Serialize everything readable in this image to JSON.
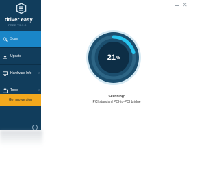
{
  "window": {
    "controls": [
      {
        "name": "minimize",
        "glyph": ""
      },
      {
        "name": "close",
        "glyph": "✕"
      }
    ]
  },
  "sidebar": {
    "brand": "driver easy",
    "version": "FREE V5.5.0",
    "items": [
      {
        "label": "Scan",
        "icon": "search-icon",
        "active": true
      },
      {
        "label": "Update",
        "icon": "update-icon",
        "active": false
      },
      {
        "label": "Hardware Info",
        "icon": "monitor-icon",
        "active": false,
        "submenu": "›"
      },
      {
        "label": "Tools",
        "icon": "toolbox-icon",
        "active": false,
        "submenu": "›"
      }
    ],
    "pro_button": "Get pro version",
    "chat_glyph": "…"
  },
  "scan": {
    "percent": 21,
    "percent_text": "21",
    "percent_sign": "%",
    "title": "Scanning:",
    "detail": "PCI standard PCI-to-PCI bridge"
  },
  "colors": {
    "sidebar": "#113d5c",
    "active": "#1a86c8",
    "pro": "#f2a81d",
    "gauge_outer": "#1b4e6e",
    "gauge_inner": "#0d2e46",
    "progress": "#27c4ef"
  }
}
